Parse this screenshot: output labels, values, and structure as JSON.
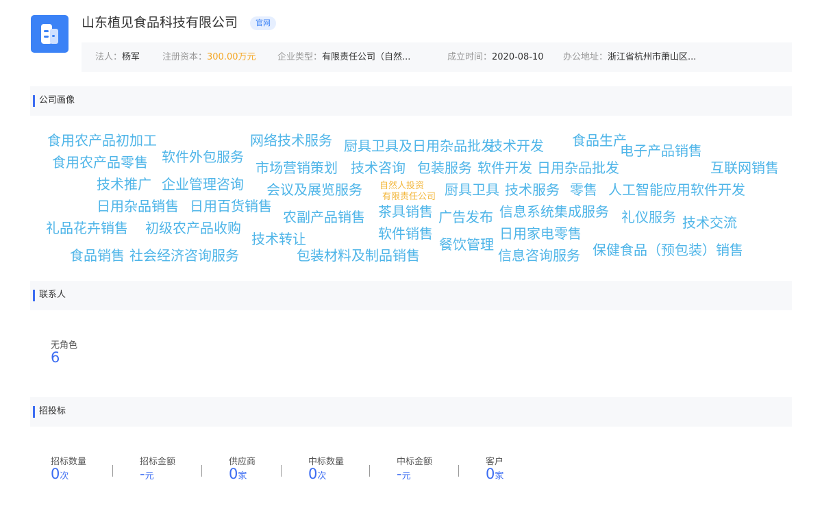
{
  "company": {
    "name": "山东植见食品科技有限公司",
    "official_tag": "官网",
    "logo_icon": "company-building-icon",
    "accent": "#3b82f6"
  },
  "info": {
    "legal_rep_label": "法人：",
    "legal_rep": "杨军",
    "capital_label": "注册资本：",
    "capital": "300.00万元",
    "type_label": "企业类型：",
    "type": "有限责任公司（自然...",
    "founded_label": "成立时间：",
    "founded": "2020-08-10",
    "address_label": "办公地址：",
    "address": "浙江省杭州市萧山区..."
  },
  "sections": {
    "portrait": "公司画像",
    "contacts": "联系人",
    "bidding": "招投标"
  },
  "word_cloud": [
    "食用农产品初加工",
    "网络技术服务",
    "厨具卫具及日用杂品批发",
    "技术开发",
    "食品生产",
    "电子产品销售",
    "食用农产品零售",
    "软件外包服务",
    "市场营销策划",
    "技术咨询",
    "包装服务",
    "软件开发",
    "日用杂品批发",
    "互联网销售",
    "技术推广",
    "企业管理咨询",
    "会议及展览服务",
    "厨具卫具",
    "技术服务",
    "零售",
    "人工智能应用软件开发",
    "日用杂品销售",
    "日用百货销售",
    "农副产品销售",
    "茶具销售",
    "广告发布",
    "信息系统集成服务",
    "礼仪服务",
    "技术交流",
    "礼品花卉销售",
    "初级农产品收购",
    "软件销售",
    "日用家电零售",
    "技术转让",
    "餐饮管理",
    "食品销售",
    "社会经济咨询服务",
    "包装材料及制品销售",
    "信息咨询服务",
    "保健食品（预包装）销售"
  ],
  "word_cloud_tags": [
    "自然人投资",
    "有限责任公司"
  ],
  "contacts": {
    "role_label": "无角色",
    "count": "6"
  },
  "bidding_stats": [
    {
      "label": "招标数量",
      "value": "0",
      "unit": "次"
    },
    {
      "label": "招标金额",
      "value": "-",
      "unit": "元"
    },
    {
      "label": "供应商",
      "value": "0",
      "unit": "家"
    },
    {
      "label": "中标数量",
      "value": "0",
      "unit": "次"
    },
    {
      "label": "中标金额",
      "value": "-",
      "unit": "元"
    },
    {
      "label": "客户",
      "value": "0",
      "unit": "家"
    }
  ]
}
